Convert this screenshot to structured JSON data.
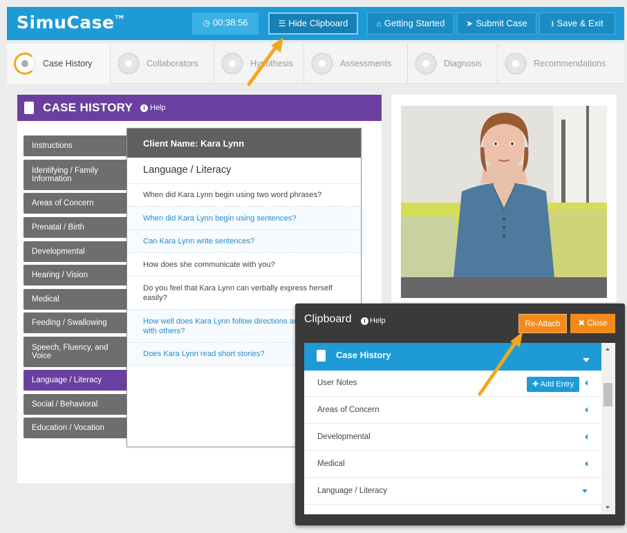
{
  "app": {
    "logo": "SimuCase",
    "logo_mark": "TM"
  },
  "topbar": {
    "timer": "00:38:56",
    "hide_clipboard": "Hide Clipboard",
    "getting_started": "Getting Started",
    "submit_case": "Submit Case",
    "save_exit": "Save & Exit"
  },
  "tabs": [
    {
      "label": "Case History"
    },
    {
      "label": "Collaborators"
    },
    {
      "label": "Hypothesis"
    },
    {
      "label": "Assessments"
    },
    {
      "label": "Diagnosis"
    },
    {
      "label": "Recommendations"
    }
  ],
  "case_history": {
    "title": "CASE HISTORY",
    "help": "Help",
    "sidebar": [
      "Instructions",
      "Identifying / Family Information",
      "Areas of Concern",
      "Prenatal / Birth",
      "Developmental",
      "Hearing / Vision",
      "Medical",
      "Feeding / Swallowing",
      "Speech, Fluency, and Voice",
      "Language / Literacy",
      "Social / Behavioral",
      "Education / Vocation"
    ],
    "active_item": "Language / Literacy",
    "client_name": "Client Name: Kara Lynn",
    "section": "Language / Literacy",
    "questions": [
      "When did Kara Lynn begin using two word phrases?",
      "When did Kara Lynn begin using sentences?",
      "Can Kara Lynn write sentences?",
      "How does she communicate with you?",
      "Do you feel that Kara Lynn can verbally express herself easily?",
      "How well does Kara Lynn follow directions and conversation with others?",
      "Does Kara Lynn read short stories?"
    ]
  },
  "clipboard": {
    "title": "Clipboard",
    "help": "Help",
    "reattach": "Re-Attach",
    "close": "Close",
    "section": "Case History",
    "rows": [
      "User Notes",
      "Areas of Concern",
      "Developmental",
      "Medical",
      "Language / Literacy"
    ],
    "add_entry": "Add Entry"
  },
  "colors": {
    "brand": "#1e9bd7",
    "case_history": "#6b3fa0",
    "accent": "#f28b1c"
  }
}
